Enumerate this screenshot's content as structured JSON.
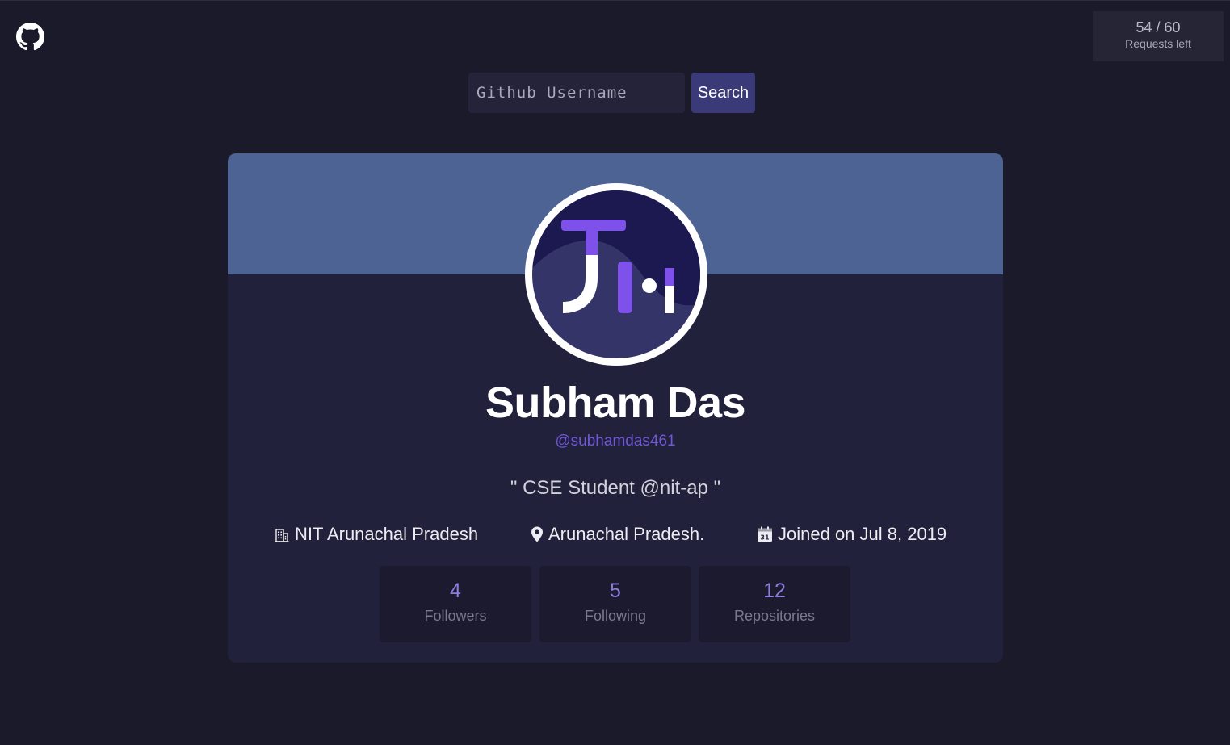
{
  "rate_limit": {
    "count": "54 / 60",
    "label": "Requests left"
  },
  "search": {
    "placeholder": "Github Username",
    "button_label": "Search"
  },
  "profile": {
    "name": "Subham Das",
    "username": "@subhamdas461",
    "bio": "\" CSE Student @nit-ap \"",
    "company": "NIT Arunachal Pradesh",
    "location": "Arunachal Pradesh.",
    "joined": "Joined on Jul 8, 2019",
    "calendar_day": "31"
  },
  "stats": [
    {
      "value": "4",
      "label": "Followers"
    },
    {
      "value": "5",
      "label": "Following"
    },
    {
      "value": "12",
      "label": "Repositories"
    }
  ],
  "icons": [
    "github-icon",
    "building-icon",
    "location-pin-icon",
    "calendar-icon"
  ],
  "colors": {
    "background": "#1b1a2b",
    "card": "#22213b",
    "banner": "#4d6393",
    "accent": "#3b3a78",
    "username": "#6e58d8",
    "stat_value": "#8d7ddc"
  }
}
